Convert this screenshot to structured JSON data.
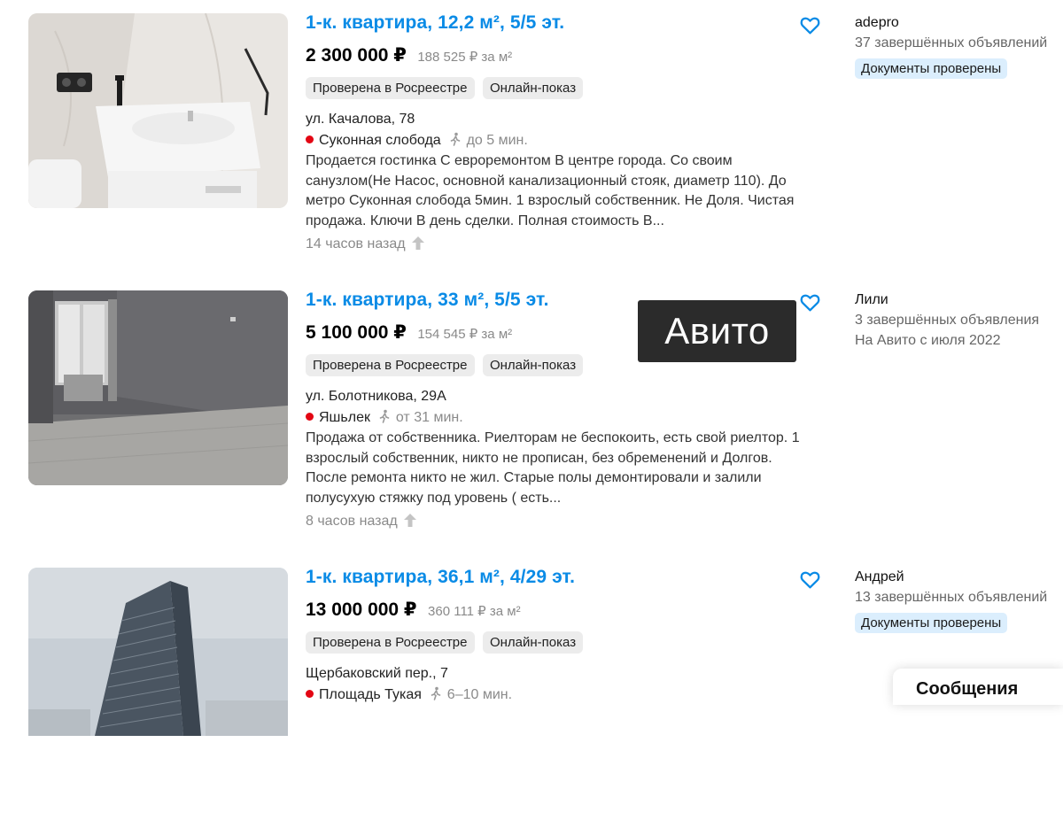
{
  "listings": [
    {
      "title": "1-к. квартира, 12,2 м², 5/5 эт.",
      "price": "2 300 000 ₽",
      "price_per_sqm": "188 525 ₽ за м²",
      "tags": [
        "Проверена в Росреестре",
        "Онлайн-показ"
      ],
      "address": "ул. Качалова, 78",
      "metro_station": "Суконная слобода",
      "metro_time": "до 5 мин.",
      "description": "Продается гостинка С евроремонтом В центре города. Со своим санузлом(Не Насос, основной канализационный стояк, диаметр 110). До метро Суконная слобода 5мин. 1 взрослый собственник. Не Доля. Чистая продажа. Ключи В день сделки. Полная стоимость В...",
      "posted": "14 часов назад",
      "seller": {
        "name": "adepro",
        "line1": "37 завершённых объявлений",
        "line2": "",
        "badge": "Документы проверены"
      }
    },
    {
      "title": "1-к. квартира, 33 м², 5/5 эт.",
      "price": "5 100 000 ₽",
      "price_per_sqm": "154 545 ₽ за м²",
      "tags": [
        "Проверена в Росреестре",
        "Онлайн-показ"
      ],
      "address": "ул. Болотникова, 29А",
      "metro_station": "Яшьлек",
      "metro_time": "от 31 мин.",
      "description": "Продажа от собственника. Риелторам не беспокоить, есть свой риелтор. 1 взрослый собственник, никто не прописан, без обременений и Долгов. После ремонта никто не жил. Старые полы демонтировали и залили полусухую стяжку под уровень ( есть...",
      "posted": "8 часов назад",
      "seller": {
        "name": "Лили",
        "line1": "3 завершённых объявления",
        "line2": "На Авито с июля 2022",
        "badge": ""
      }
    },
    {
      "title": "1-к. квартира, 36,1 м², 4/29 эт.",
      "price": "13 000 000 ₽",
      "price_per_sqm": "360 111 ₽ за м²",
      "tags": [
        "Проверена в Росреестре",
        "Онлайн-показ"
      ],
      "address": "Щербаковский пер., 7",
      "metro_station": "Площадь Тукая",
      "metro_time": "6–10 мин.",
      "description": "",
      "posted": "",
      "seller": {
        "name": "Андрей",
        "line1": "13 завершённых объявлений",
        "line2": "",
        "badge": "Документы проверены"
      }
    }
  ],
  "watermark": "Авито",
  "messages_label": "Сообщения",
  "colors": {
    "link": "#0a8be6",
    "metro_red": "#e30613",
    "tag_bg": "#ececec",
    "badge_bg": "#dbeefd",
    "muted": "#8a8a8a"
  }
}
